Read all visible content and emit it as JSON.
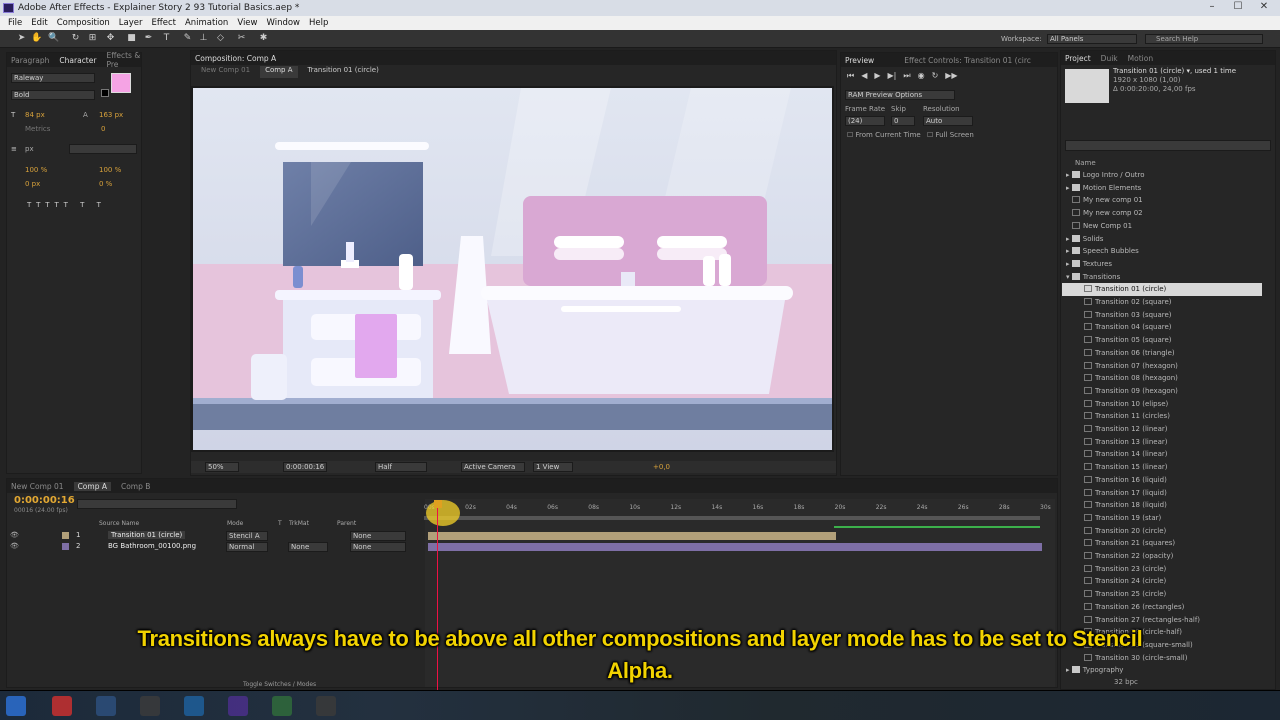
{
  "window": {
    "title": "Adobe After Effects - Explainer Story 2 93 Tutorial Basics.aep *"
  },
  "menu": [
    "File",
    "Edit",
    "Composition",
    "Layer",
    "Effect",
    "Animation",
    "View",
    "Window",
    "Help"
  ],
  "toolbar": {
    "workspace_label": "Workspace:",
    "workspace_value": "All Panels",
    "search_placeholder": "Search Help"
  },
  "left_panel": {
    "tabs": [
      "Paragraph",
      "Character",
      "Effects & Pre"
    ],
    "font": "Raleway",
    "style": "Bold",
    "font_size": "84 px",
    "tracking_label": "Metrics",
    "leading": "163 px",
    "kerning": "0",
    "stroke": "px",
    "vscale": "100 %",
    "hscale": "100 %",
    "baseline": "0 px",
    "tsume": "0 %"
  },
  "comp_panel": {
    "tab": "Composition: Comp A",
    "sub_tabs": [
      "New Comp 01",
      "Comp A"
    ],
    "breadcrumb": "Transition 01 (circle)",
    "zoom": "50%",
    "timecode": "0:00:00:16",
    "resolution": "Half",
    "camera": "Active Camera",
    "view": "1 View",
    "exposure": "+0,0"
  },
  "preview": {
    "tabs": [
      "Preview",
      "Effect Controls: Transition 01 (circ"
    ],
    "ram": "RAM Preview Options",
    "labels": {
      "frame_rate": "Frame Rate",
      "skip": "Skip",
      "resolution": "Resolution"
    },
    "frame_rate": "(24)",
    "skip": "0",
    "resolution": "Auto",
    "from_current": "From Current Time",
    "full_screen": "Full Screen"
  },
  "project": {
    "tabs": [
      "Project",
      "Duik",
      "Motion"
    ],
    "info_name": "Transition 01 (circle) ▾, used 1 time",
    "info_line1": "1920 x 1080 (1,00)",
    "info_line2": "Δ 0:00:20:00, 24,00 fps",
    "column": "Name",
    "items": [
      {
        "label": "Logo Intro / Outro",
        "type": "folder"
      },
      {
        "label": "Motion Elements",
        "type": "folder"
      },
      {
        "label": "My new comp 01",
        "type": "comp"
      },
      {
        "label": "My new comp 02",
        "type": "comp"
      },
      {
        "label": "New Comp 01",
        "type": "comp"
      },
      {
        "label": "Solids",
        "type": "folder"
      },
      {
        "label": "Speech Bubbles",
        "type": "folder"
      },
      {
        "label": "Textures",
        "type": "folder"
      },
      {
        "label": "Transitions",
        "type": "folder"
      },
      {
        "label": "Transition 01 (circle)",
        "type": "comp",
        "selected": true
      },
      {
        "label": "Transition 02 (square)",
        "type": "comp"
      },
      {
        "label": "Transition 03 (square)",
        "type": "comp"
      },
      {
        "label": "Transition 04 (square)",
        "type": "comp"
      },
      {
        "label": "Transition 05 (square)",
        "type": "comp"
      },
      {
        "label": "Transition 06 (triangle)",
        "type": "comp"
      },
      {
        "label": "Transition 07 (hexagon)",
        "type": "comp"
      },
      {
        "label": "Transition 08 (hexagon)",
        "type": "comp"
      },
      {
        "label": "Transition 09 (hexagon)",
        "type": "comp"
      },
      {
        "label": "Transition 10 (elipse)",
        "type": "comp"
      },
      {
        "label": "Transition 11 (circles)",
        "type": "comp"
      },
      {
        "label": "Transition 12 (linear)",
        "type": "comp"
      },
      {
        "label": "Transition 13 (linear)",
        "type": "comp"
      },
      {
        "label": "Transition 14 (linear)",
        "type": "comp"
      },
      {
        "label": "Transition 15 (linear)",
        "type": "comp"
      },
      {
        "label": "Transition 16 (liquid)",
        "type": "comp"
      },
      {
        "label": "Transition 17 (liquid)",
        "type": "comp"
      },
      {
        "label": "Transition 18 (liquid)",
        "type": "comp"
      },
      {
        "label": "Transition 19 (star)",
        "type": "comp"
      },
      {
        "label": "Transition 20 (circle)",
        "type": "comp"
      },
      {
        "label": "Transition 21 (squares)",
        "type": "comp"
      },
      {
        "label": "Transition 22 (opacity)",
        "type": "comp"
      },
      {
        "label": "Transition 23 (circle)",
        "type": "comp"
      },
      {
        "label": "Transition 24 (circle)",
        "type": "comp"
      },
      {
        "label": "Transition 25 (circle)",
        "type": "comp"
      },
      {
        "label": "Transition 26 (rectangles)",
        "type": "comp"
      },
      {
        "label": "Transition 27 (rectangles-half)",
        "type": "comp"
      },
      {
        "label": "Transition 28 (circle-half)",
        "type": "comp"
      },
      {
        "label": "Transition 29 (square-small)",
        "type": "comp"
      },
      {
        "label": "Transition 30 (circle-small)",
        "type": "comp"
      },
      {
        "label": "Typography",
        "type": "folder"
      }
    ],
    "bpc": "32 bpc"
  },
  "timeline": {
    "tabs": [
      "New Comp 01",
      "Comp A",
      "Comp B"
    ],
    "timecode": "0:00:00:16",
    "frames": "00016 (24.00 fps)",
    "columns": {
      "source": "Source Name",
      "mode": "Mode",
      "t": "T",
      "trkmat": "TrkMat",
      "parent": "Parent"
    },
    "layers": [
      {
        "num": "1",
        "name": "Transition 01 (circle)",
        "mode": "Stencil A",
        "trkmat": "",
        "parent": "None",
        "color": "#b2a07a"
      },
      {
        "num": "2",
        "name": "BG Bathroom_00100.png",
        "mode": "Normal",
        "trkmat": "None",
        "parent": "None",
        "color": "#7e6fa6"
      }
    ],
    "ruler": [
      "00s",
      "02s",
      "04s",
      "06s",
      "08s",
      "10s",
      "12s",
      "14s",
      "16s",
      "18s",
      "20s",
      "22s",
      "24s",
      "26s",
      "28s",
      "30s"
    ],
    "footer": "Toggle Switches / Modes"
  },
  "caption": {
    "line1": "Transitions always have to be above all other compositions and layer mode has to be set to Stencil",
    "line2": "Alpha."
  },
  "colors": {
    "accent": "#d7a13b",
    "caption": "#f2d300",
    "selection": "#d8d8d8"
  }
}
